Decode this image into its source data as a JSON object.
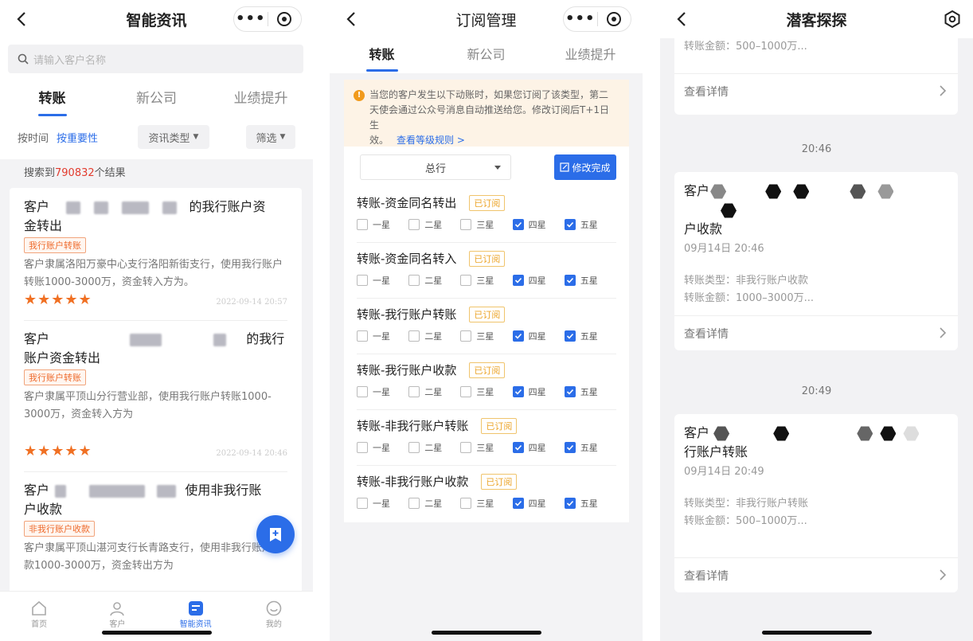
{
  "screen1": {
    "title": "智能资讯",
    "search_placeholder": "请输入客户名称",
    "tabs": [
      "转账",
      "新公司",
      "业绩提升"
    ],
    "sort_time": "按时间",
    "sort_importance": "按重要性",
    "type_filter": "资讯类型",
    "filter": "筛选",
    "result_prefix": "搜索到",
    "result_count": "790832",
    "result_suffix": "个结果",
    "items": [
      {
        "title_a": "客户",
        "title_b": "的我行账户资",
        "title_c": "金转出",
        "tag": "我行账户转账",
        "desc": "客户隶属洛阳万豪中心支行洛阳新街支行，使用我行账户转账1000-3000万，资金转入方为。",
        "stars": "★★★★★",
        "time": "2022-09-14 20:57"
      },
      {
        "title_a": "客户",
        "title_b": "的我行",
        "title_c": "账户资金转出",
        "tag": "我行账户转账",
        "desc": "客户隶属平顶山分行营业部，使用我行账户转账1000-3000万，资金转入方为",
        "stars": "★★★★★",
        "time": "2022-09-14 20:46"
      },
      {
        "title_a": "客户",
        "title_b": "使用非我行账",
        "title_c": "户收款",
        "tag": "非我行账户收款",
        "desc": "客户隶属平顶山湛河支行长青路支行，使用非我行账户收款1000-3000万，资金转出方为",
        "stars": "",
        "time": ""
      }
    ],
    "tabbar": [
      "首页",
      "客户",
      "智能资讯",
      "我的"
    ]
  },
  "screen2": {
    "title": "订阅管理",
    "tabs": [
      "转账",
      "新公司",
      "业绩提升"
    ],
    "notice_line1": "当您的客户发生以下动账时，如果您订阅了该类型，第二",
    "notice_line2": "天使会通过公众号消息自动推送给您。修改订阅后T+1日生",
    "notice_line3": "效。",
    "notice_link": "查看等级规则 >",
    "select_value": "总行",
    "done_button": "修改完成",
    "star_labels": [
      "一星",
      "二星",
      "三星",
      "四星",
      "五星"
    ],
    "subscriptions": [
      {
        "name": "转账-资金同名转出",
        "badge": "已订阅"
      },
      {
        "name": "转账-资金同名转入",
        "badge": "已订阅"
      },
      {
        "name": "转账-我行账户转账",
        "badge": "已订阅"
      },
      {
        "name": "转账-我行账户收款",
        "badge": "已订阅"
      },
      {
        "name": "转账-非我行账户转账",
        "badge": "已订阅"
      },
      {
        "name": "转账-非我行账户收款",
        "badge": "已订阅"
      }
    ]
  },
  "screen3": {
    "title": "潜客探探",
    "top_amount": "转账金额：500–1000万...",
    "detail": "查看详情",
    "time1": "20:46",
    "msg1": {
      "title_a": "客户",
      "title_b": "户收款",
      "date": "09月14日 20:46",
      "type": "转账类型：非我行账户收款",
      "amount": "转账金额：1000–3000万..."
    },
    "time2": "20:49",
    "msg2": {
      "title_a": "客户",
      "title_b": "行账户转账",
      "date": "09月14日 20:49",
      "type": "转账类型：非我行账户转账",
      "amount": "转账金额：500–1000万..."
    }
  },
  "colors": {
    "primary": "#2b6de8",
    "star": "#f07023",
    "badge": "#eca52a",
    "red_count": "#e23b2e"
  }
}
